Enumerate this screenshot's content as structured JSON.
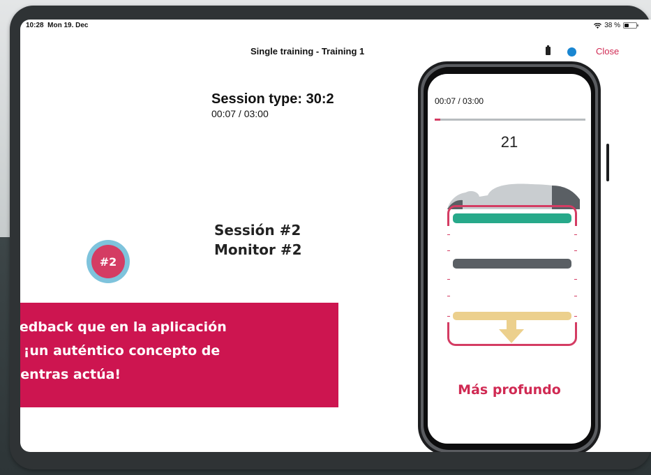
{
  "status_bar": {
    "time": "10:28",
    "date": "Mon 19. Dec",
    "battery": "38 %",
    "wifi_icon": "wifi-icon",
    "battery_icon": "battery-icon"
  },
  "nav": {
    "title": "Single training - Training 1",
    "close_label": "Close",
    "device_indicator_color": "#1a86d1",
    "device_battery_icon": "device-battery-icon"
  },
  "session": {
    "type_label": "Session type: 30:2",
    "elapsed": "00:07 / 03:00"
  },
  "overlay": {
    "session_label": "Sessión #2",
    "monitor_label": "Monitor #2",
    "badge": "#2"
  },
  "banner": {
    "line1": "o feedback que en la aplicación",
    "line2": "h®: ¡un auténtico concepto de",
    "line3": "r mientras actúa!",
    "color": "#cd1550"
  },
  "phone": {
    "elapsed": "00:07 / 03:00",
    "progress_fraction": 0.039,
    "compression_count": "21",
    "instruction": "Más profundo",
    "accent_color": "#d43c63",
    "bar_colors": {
      "top": "#27a98a",
      "middle": "#5a5f64",
      "bottom": "#ecd08d"
    }
  }
}
